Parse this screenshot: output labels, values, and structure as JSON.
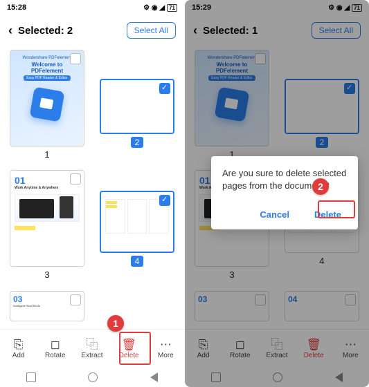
{
  "left": {
    "status_time": "15:28",
    "status_batt": "71",
    "header_title": "Selected: 2",
    "select_all": "Select All",
    "welcome_line1": "Welcome to",
    "welcome_line2": "PDFelement",
    "brand": "Wondershare PDFelement",
    "pages": [
      "1",
      "2",
      "3",
      "4"
    ],
    "p5_num": "03",
    "p5_sub": "Intelligent Read Mode",
    "p3_num": "01",
    "p3_sub": "Work Anytime & Anywhere",
    "toolbar": {
      "add": "Add",
      "rotate": "Rotate",
      "extract": "Extract",
      "delete": "Delete",
      "more": "More"
    },
    "callout1": "1"
  },
  "right": {
    "status_time": "15:29",
    "status_batt": "71",
    "header_title": "Selected: 1",
    "select_all": "Select All",
    "pages": [
      "1",
      "2",
      "3",
      "4"
    ],
    "p5_num": "03",
    "p6_num": "04",
    "dialog_msg": "Are you sure to delete selected pages from the document?",
    "dialog_cancel": "Cancel",
    "dialog_delete": "Delete",
    "toolbar": {
      "add": "Add",
      "rotate": "Rotate",
      "extract": "Extract",
      "delete": "Delete",
      "more": "More"
    },
    "callout2": "2"
  }
}
